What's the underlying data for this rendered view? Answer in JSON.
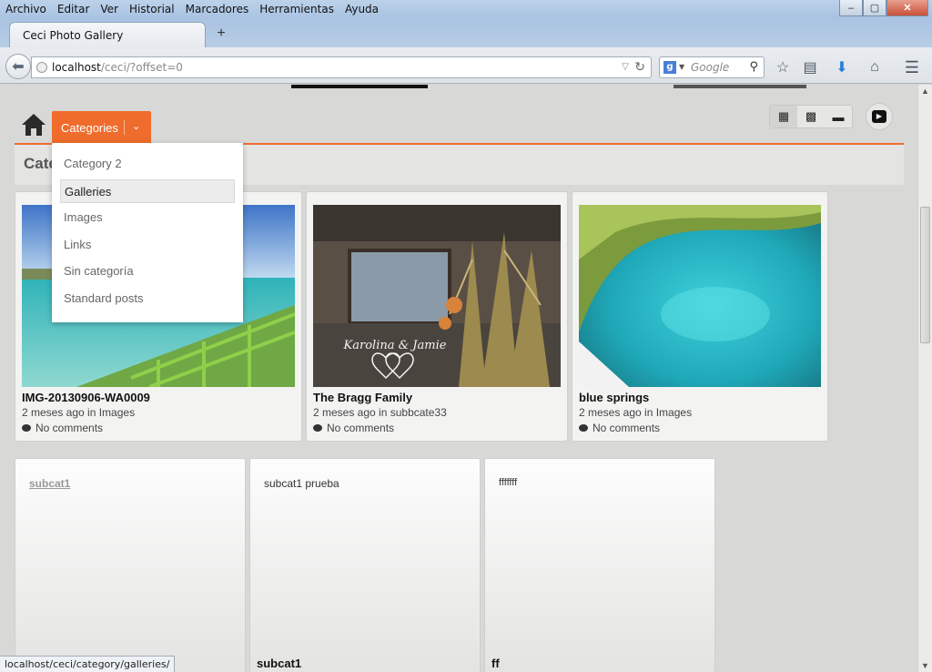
{
  "menubar": {
    "items": [
      "Archivo",
      "Editar",
      "Ver",
      "Historial",
      "Marcadores",
      "Herramientas",
      "Ayuda"
    ]
  },
  "window_controls": {
    "minimize": "–",
    "maximize": "▢",
    "close": "✕"
  },
  "tab": {
    "title": "Ceci Photo Gallery",
    "new_tab": "+"
  },
  "navbar": {
    "url_host": "localhost",
    "url_path": "/ceci/?offset=0",
    "search_placeholder": "Google"
  },
  "toolbar": {
    "categories_label": "Categories",
    "header_text": "Cate"
  },
  "dropdown": {
    "items": [
      {
        "label": "Category 2",
        "active": false
      },
      {
        "label": "Galleries",
        "active": true
      },
      {
        "label": "Images",
        "active": false
      },
      {
        "label": "Links",
        "active": false
      },
      {
        "label": "Sin categoría",
        "active": false
      },
      {
        "label": "Standard posts",
        "active": false
      }
    ]
  },
  "posts": [
    {
      "title": "IMG-20130906-WA0009",
      "meta": "2 meses ago in Images",
      "comments": "No comments"
    },
    {
      "title": "The Bragg Family",
      "meta": "2 meses ago in subbcate33",
      "comments": "No comments",
      "overlay": "Karolina & Jamie"
    },
    {
      "title": "blue springs",
      "meta": "2 meses ago in Images",
      "comments": "No comments"
    }
  ],
  "subcategories": [
    {
      "label": "subcat1",
      "title": ""
    },
    {
      "label": "subcat1 prueba",
      "title": "subcat1"
    },
    {
      "label": "fffffff",
      "title": "ff"
    }
  ],
  "status_url": "localhost/ceci/category/galleries/",
  "colors": {
    "accent": "#ef6c2c"
  }
}
